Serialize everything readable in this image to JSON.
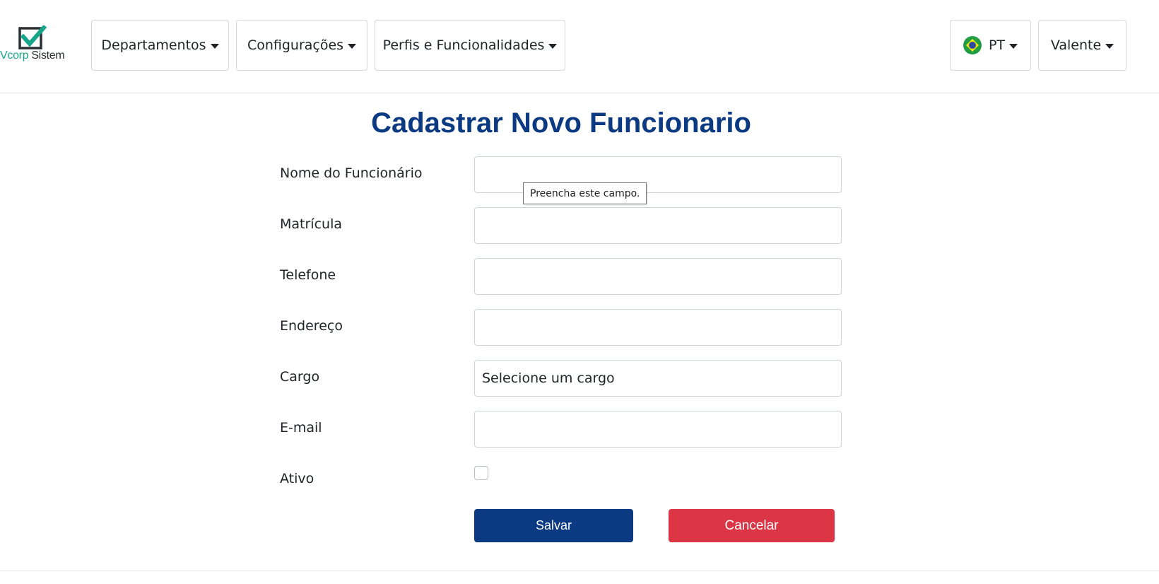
{
  "brand": {
    "name_part1": "Vcorp",
    "name_part2": "Sistem"
  },
  "nav": {
    "departamentos": "Departamentos",
    "configuracoes": "Configurações",
    "perfis": "Perfis e Funcionalidades",
    "language": "PT",
    "user": "Valente"
  },
  "form": {
    "title": "Cadastrar Novo Funcionario",
    "fields": {
      "nome": {
        "label": "Nome do Funcionário",
        "value": ""
      },
      "matricula": {
        "label": "Matrícula",
        "value": ""
      },
      "telefone": {
        "label": "Telefone",
        "value": ""
      },
      "endereco": {
        "label": "Endereço",
        "value": ""
      },
      "cargo": {
        "label": "Cargo",
        "value": "Selecione um cargo"
      },
      "email": {
        "label": "E-mail",
        "value": ""
      },
      "ativo": {
        "label": "Ativo",
        "checked": false
      }
    },
    "validation_tooltip": "Preencha este campo.",
    "save_label": "Salvar",
    "cancel_label": "Cancelar"
  },
  "colors": {
    "primary": "#0b3a82",
    "danger": "#dc3545",
    "brand_green": "#17a589"
  }
}
